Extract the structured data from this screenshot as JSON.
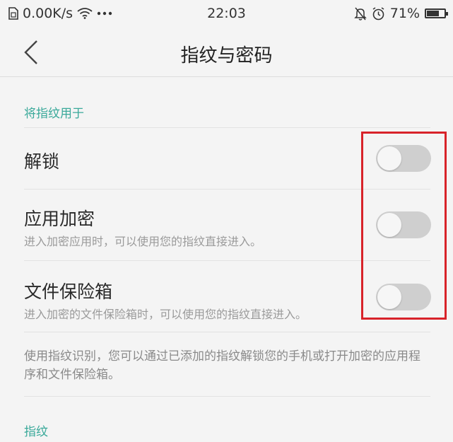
{
  "status_bar": {
    "net_speed": "0.00K/s",
    "time": "22:03",
    "battery_percent": "71%",
    "battery_level": 0.71,
    "icons": [
      "sim-icon",
      "wifi-icon",
      "more-dots-icon",
      "mute-icon",
      "alarm-icon",
      "battery-icon"
    ]
  },
  "nav": {
    "title": "指纹与密码"
  },
  "section_use": {
    "header": "将指纹用于"
  },
  "settings": [
    {
      "title": "解锁",
      "subtitle": "",
      "enabled": false
    },
    {
      "title": "应用加密",
      "subtitle": "进入加密应用时，可以使用您的指纹直接进入。",
      "enabled": false
    },
    {
      "title": "文件保险箱",
      "subtitle": "进入加密的文件保险箱时，可以使用您的指纹直接进入。",
      "enabled": false
    }
  ],
  "description": "使用指纹识别，您可以通过已添加的指纹解锁您的手机或打开加密的应用程序和文件保险箱。",
  "section_fingerprint": {
    "header": "指纹"
  },
  "colors": {
    "accent": "#3aa99a",
    "highlight": "#d8232a",
    "switch_off": "#cfcfcf"
  }
}
